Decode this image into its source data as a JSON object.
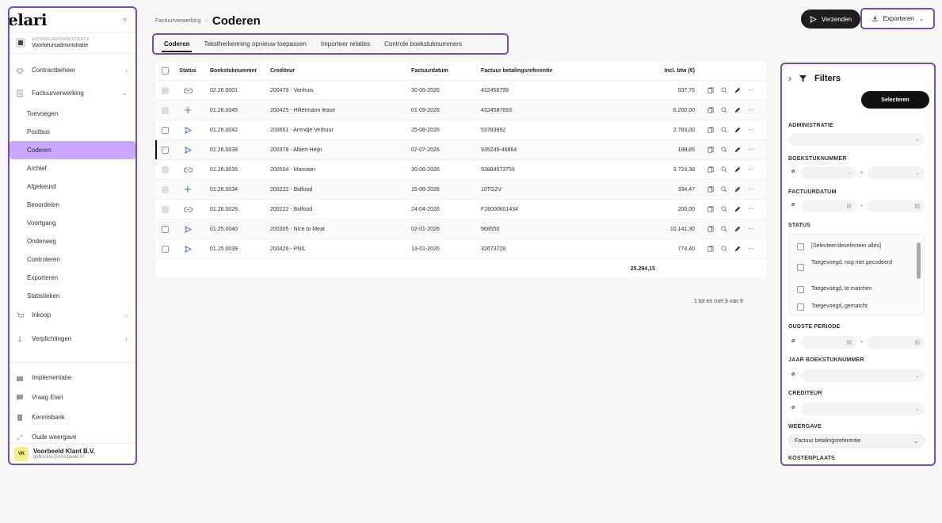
{
  "app": {
    "logo": "elari",
    "collapse_icon": "chevrons-left-icon"
  },
  "admin": {
    "label": "VOORKEURADMINISTRATIE",
    "value": "Voorkeursadministratie"
  },
  "sidebar": {
    "items": [
      {
        "label": "Contractbeheer",
        "icon": "diamond-icon"
      },
      {
        "label": "Factuurverwerking",
        "icon": "document-icon"
      }
    ],
    "subitems": [
      "Toevoegen",
      "Postbus",
      "Coderen",
      "Archief",
      "Afgekeurd",
      "Beoordelen",
      "Voortgang",
      "Onderweg",
      "Controleren",
      "Exporteren",
      "Statistieken"
    ],
    "items2": [
      {
        "label": "Inkoop",
        "icon": "cart-icon"
      },
      {
        "label": "Verplichtingen",
        "icon": "pin-icon"
      }
    ],
    "bottom": [
      {
        "label": "Implementatie",
        "icon": "briefcase-icon"
      },
      {
        "label": "Vraag Elari",
        "icon": "chat-icon"
      },
      {
        "label": "Kennisbank",
        "icon": "book-icon"
      },
      {
        "label": "Oude weergave",
        "icon": "swap-icon"
      }
    ],
    "user": {
      "initials": "VK",
      "name": "Voorbeeld Klant B.V.",
      "email": "gebruiker@voorbeeld.nl"
    }
  },
  "header": {
    "breadcrumb_parent": "Factuurverwerking",
    "title": "Coderen",
    "send_label": "Verzenden",
    "export_label": "Exporteren"
  },
  "tabs": [
    "Coderen",
    "Tekstherkenning opnieuw toepassen",
    "Importeer relaties",
    "Controle boekstuknummers"
  ],
  "table": {
    "columns": [
      "Status",
      "Boekstuknummer",
      "Crediteur",
      "Factuurdatum",
      "Factuur betalingsreferentie",
      "Incl. btw (€)"
    ],
    "rows": [
      {
        "status": "link",
        "nr": "02.26.0001",
        "crediteur": "200479 - Venhuis",
        "datum": "30-06-2026",
        "ref": "432456799",
        "amount": "937,75"
      },
      {
        "status": "plus",
        "nr": "01.26.0045",
        "crediteur": "200425 - Hiltermann lease",
        "datum": "01-09-2026",
        "ref": "4324587693",
        "amount": "6.200,00"
      },
      {
        "status": "send",
        "nr": "01.26.0042",
        "crediteur": "200651 - Arendje Verhuur",
        "datum": "25-08-2026",
        "ref": "53783892",
        "amount": "2.783,00"
      },
      {
        "status": "send",
        "nr": "01.26.0038",
        "crediteur": "200378 - Albert Heijn",
        "datum": "07-07-2026",
        "ref": "935245-46864",
        "amount": "198,85"
      },
      {
        "status": "link",
        "nr": "01.26.0035",
        "crediteur": "200504 - Manutan",
        "datum": "30-06-2026",
        "ref": "93884573759",
        "amount": "3.724,38"
      },
      {
        "status": "plus",
        "nr": "01.26.0034",
        "crediteur": "200222 - Bidfood",
        "datum": "15-06-2026",
        "ref": "10TG2V",
        "amount": "334,47"
      },
      {
        "status": "link",
        "nr": "01.26.0028",
        "crediteur": "200222 - Bidfood",
        "datum": "24-04-2026",
        "ref": "F28000601434",
        "amount": "200,00"
      },
      {
        "status": "send",
        "nr": "01.25.0040",
        "crediteur": "200305 - Nice to Meat",
        "datum": "02-01-2026",
        "ref": "968550",
        "amount": "10.141,30"
      },
      {
        "status": "send",
        "nr": "01.25.0039",
        "crediteur": "200426 - PNIL",
        "datum": "13-01-2026",
        "ref": "32673728",
        "amount": "774,40"
      }
    ],
    "total": "25.294,15",
    "pager": "1 tot en met 9 van 9"
  },
  "filters": {
    "title": "Filters",
    "select_label": "Selecteren",
    "administratie": "ADMINISTRATIE",
    "boekstuknummer": "BOEKSTUKNUMMER",
    "factuurdatum": "FACTUURDATUM",
    "status": "STATUS",
    "status_options": [
      "[Selecteer/deselecteer alles]",
      "Toegevoegd, nog niet gecodeerd",
      "Toegevoegd, te matchen",
      "Toegevoegd, gematcht"
    ],
    "oudste_periode": "OUDSTE PERIODE",
    "jaar": "JAAR BOEKSTUKNUMMER",
    "crediteur": "CREDITEUR",
    "weergave": "WEERGAVE",
    "weergave_value": "Factuur betalingsreferentie",
    "kostenplaats": "KOSTENPLAATS",
    "null_symbol": "ø",
    "dash": "-"
  },
  "colors": {
    "accent": "#c9a9ff",
    "outline": "#7a4ea6",
    "dark": "#1e1e1e"
  }
}
